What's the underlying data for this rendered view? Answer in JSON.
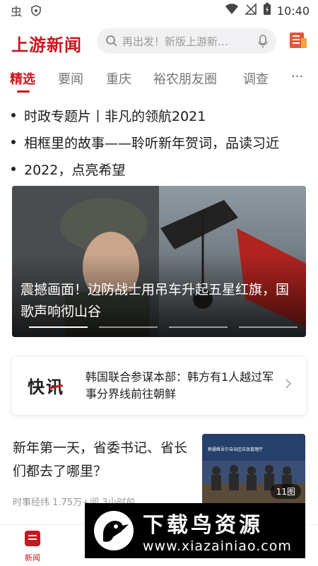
{
  "status_bar": {
    "time": "10:40"
  },
  "header": {
    "logo": "上游新闻",
    "search_placeholder": "再出发！新版上游新…"
  },
  "tabs": [
    {
      "label": "精选",
      "active": true
    },
    {
      "label": "要闻",
      "active": false
    },
    {
      "label": "重庆",
      "active": false
    },
    {
      "label": "裕农朋友圈",
      "active": false
    },
    {
      "label": "调查",
      "active": false
    }
  ],
  "more_label": "···",
  "headlines": [
    "时政专题片丨非凡的领航2021",
    "相框里的故事——聆听新年贺词，品读习近",
    "2022，点亮希望"
  ],
  "banner": {
    "caption": "震撼画面！边防战士用吊车升起五星红旗，国歌声响彻山谷",
    "slides": 4,
    "active_slide": 0
  },
  "flash": {
    "tag": "快讯",
    "text": "韩国联合参谋本部：韩方有1人越过军事分界线前往朝鲜"
  },
  "article": {
    "title": "新年第一天，省委书记、省长们都去了哪里？",
    "meta": "时事经纬  1.75万+阅  3小时前",
    "image_count": "11图",
    "image_sign": "新疆维吾尔自治区应急管理厅"
  },
  "bottom_nav": {
    "news_label": "新闻"
  },
  "watermark": {
    "title": "下载鸟资源",
    "url": "www.xiazainiao.com"
  },
  "colors": {
    "brand_red": "#c8171e",
    "tab_inactive": "#777777"
  }
}
